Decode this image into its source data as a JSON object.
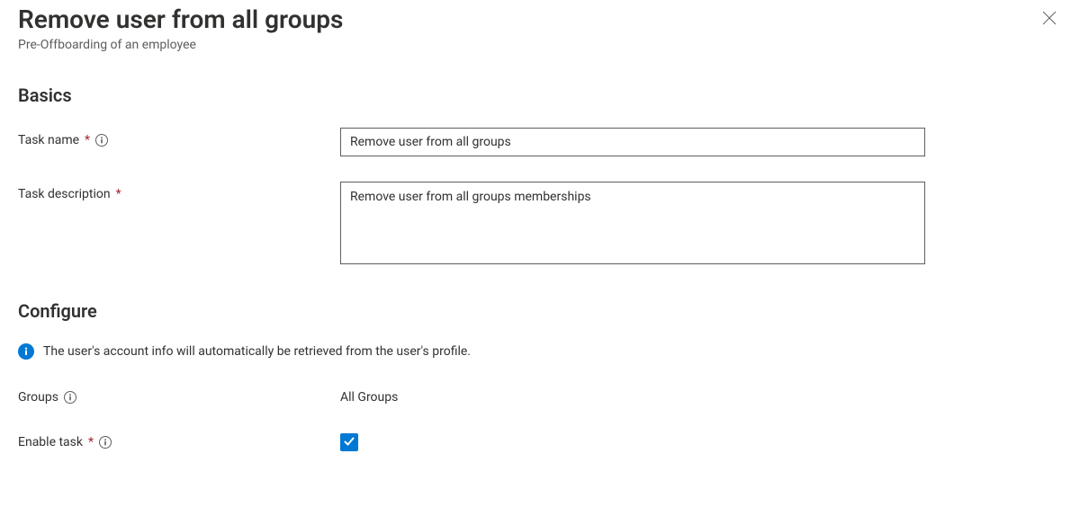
{
  "header": {
    "title": "Remove user from all groups",
    "subtitle": "Pre-Offboarding of an employee"
  },
  "sections": {
    "basics": {
      "heading": "Basics",
      "task_name_label": "Task name",
      "task_name_value": "Remove user from all groups",
      "task_description_label": "Task description",
      "task_description_value": "Remove user from all groups memberships"
    },
    "configure": {
      "heading": "Configure",
      "info_text": "The user's account info will automatically be retrieved from the user's profile.",
      "groups_label": "Groups",
      "groups_value": "All Groups",
      "enable_task_label": "Enable task",
      "enable_task_checked": true
    }
  }
}
